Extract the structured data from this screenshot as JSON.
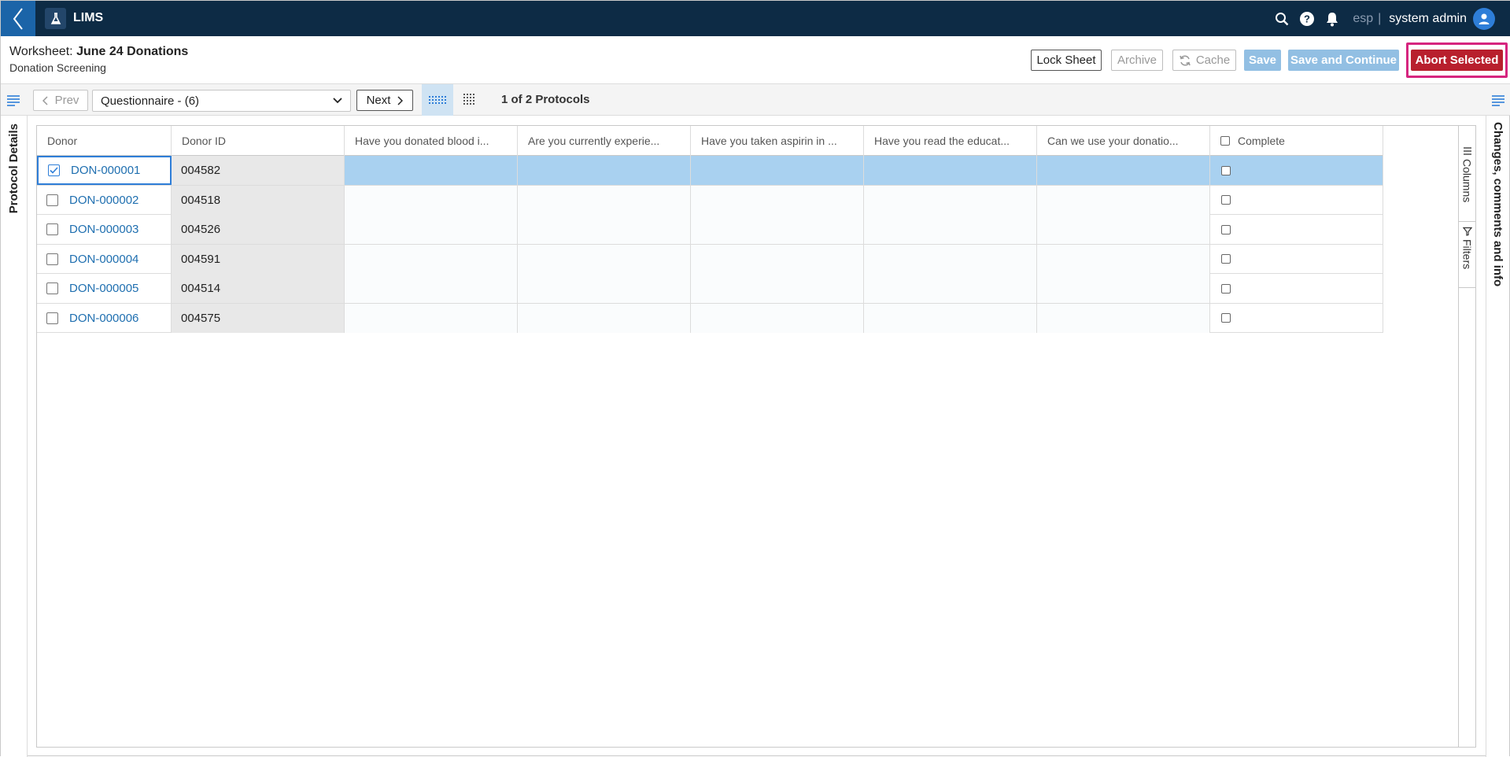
{
  "app": {
    "name": "LIMS"
  },
  "topbar": {
    "tenant": "esp",
    "separator": "|",
    "user": "system admin"
  },
  "worksheet": {
    "label": "Worksheet:",
    "name": "June 24 Donations",
    "subtitle": "Donation Screening"
  },
  "actions": {
    "lock_sheet": "Lock Sheet",
    "archive": "Archive",
    "cache": "Cache",
    "save": "Save",
    "save_continue": "Save and Continue",
    "abort_selected": "Abort Selected"
  },
  "toolbar": {
    "prev": "Prev",
    "next": "Next",
    "protocol_select": "Questionnaire - (6)",
    "protocol_count": "1 of 2 Protocols"
  },
  "side_panels": {
    "left": "Protocol Details",
    "right": "Changes, comments and info"
  },
  "grid_tools": {
    "columns": "Columns",
    "filters": "Filters"
  },
  "table": {
    "headers": {
      "donor": "Donor",
      "donor_id": "Donor ID",
      "q1": "Have you donated blood i...",
      "q2": "Are you currently experie...",
      "q3": "Have you taken aspirin in ...",
      "q4": "Have you read the educat...",
      "q5": "Can we use your donatio...",
      "complete": "Complete"
    },
    "rows": [
      {
        "donor": "DON-000001",
        "donor_id": "004582",
        "selected": true
      },
      {
        "donor": "DON-000002",
        "donor_id": "004518",
        "selected": false
      },
      {
        "donor": "DON-000003",
        "donor_id": "004526",
        "selected": false
      },
      {
        "donor": "DON-000004",
        "donor_id": "004591",
        "selected": false
      },
      {
        "donor": "DON-000005",
        "donor_id": "004514",
        "selected": false
      },
      {
        "donor": "DON-000006",
        "donor_id": "004575",
        "selected": false
      }
    ]
  },
  "colors": {
    "topbar": "#0d2b45",
    "back": "#1b64a8",
    "abort": "#b81f2d",
    "highlight": "#d6257f",
    "selected_row": "#a9d1f0",
    "link": "#1f6fb0"
  }
}
